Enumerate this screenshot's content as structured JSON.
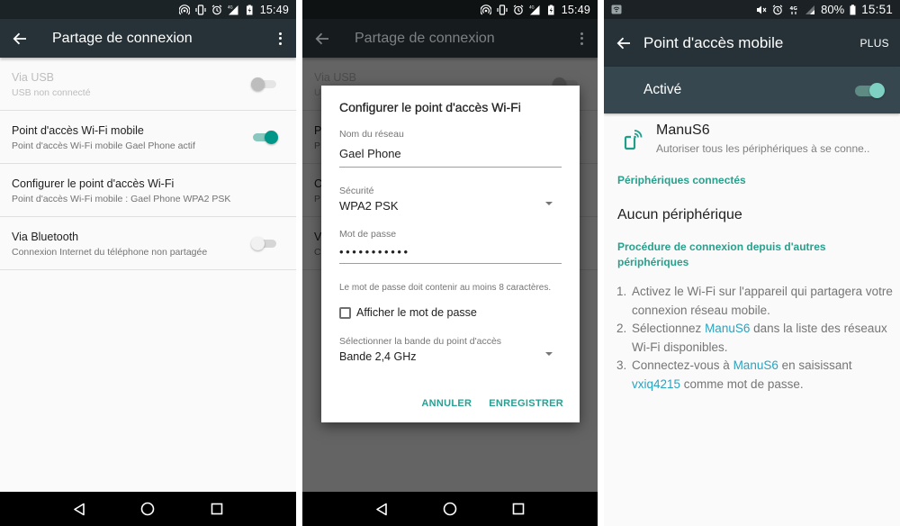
{
  "panel1": {
    "status_bar": {
      "icons": [
        "hotspot-icon",
        "vibrate-icon",
        "alarm-icon",
        "signal-4g-icon",
        "battery-charging-icon"
      ],
      "time": "15:49"
    },
    "app_bar": {
      "back_icon": "arrow-left-icon",
      "title": "Partage de connexion",
      "menu_icon": "more-vert-icon"
    },
    "items": [
      {
        "title": "Via USB",
        "subtitle": "USB non connecté",
        "toggle": false,
        "enabled": false
      },
      {
        "title": "Point d'accès Wi-Fi mobile",
        "subtitle": "Point d'accès Wi-Fi mobile Gael Phone actif",
        "toggle": true,
        "enabled": true
      },
      {
        "title": "Configurer le point d'accès Wi-Fi",
        "subtitle": "Point d'accès Wi-Fi mobile : Gael Phone WPA2 PSK"
      },
      {
        "title": "Via Bluetooth",
        "subtitle": "Connexion Internet du téléphone non partagée",
        "toggle": false,
        "enabled": true
      }
    ],
    "nav_bar": [
      "back-triangle-icon",
      "home-circle-icon",
      "recents-square-icon"
    ]
  },
  "panel2": {
    "status_bar": {
      "time": "15:49"
    },
    "app_bar": {
      "title": "Partage de connexion"
    },
    "background_items": [
      {
        "title": "Via USB",
        "subtitle": "USB non connecté"
      },
      {
        "title": "P",
        "subtitle": "P"
      },
      {
        "title": "C",
        "subtitle": "P"
      },
      {
        "title": "V",
        "subtitle": "C"
      }
    ],
    "dialog": {
      "title": "Configurer le point d'accès Wi-Fi",
      "network_name_label": "Nom du réseau",
      "network_name_value": "Gael Phone",
      "security_label": "Sécurité",
      "security_value": "WPA2 PSK",
      "password_label": "Mot de passe",
      "password_masked": "•••••••••••",
      "password_hint": "Le mot de passe doit contenir au moins 8 caractères.",
      "show_password_label": "Afficher le mot de passe",
      "show_password_checked": false,
      "band_label": "Sélectionner la bande du point d'accès",
      "band_value": "Bande 2,4 GHz",
      "cancel_label": "ANNULER",
      "save_label": "ENREGISTRER"
    }
  },
  "panel3": {
    "status_bar": {
      "left_icon": "wifi-hotspot-notification-icon",
      "icons": [
        "mute-icon",
        "alarm-icon",
        "4g-icon",
        "signal-icon"
      ],
      "battery": "80%",
      "time": "15:51"
    },
    "app_bar": {
      "title": "Point d'accès mobile",
      "more_label": "PLUS"
    },
    "master_toggle": {
      "label": "Activé",
      "on": true
    },
    "network": {
      "icon": "phone-wifi-icon",
      "name": "ManuS6",
      "subtitle": "Autoriser tous les périphériques à se conne.."
    },
    "connected_header": "Périphériques connectés",
    "no_devices": "Aucun périphérique",
    "procedure_header": "Procédure de connexion depuis d'autres périphériques",
    "steps": [
      {
        "num": "1.",
        "parts": [
          "Activez le Wi-Fi sur l'appareil qui partagera votre connexion réseau mobile."
        ]
      },
      {
        "num": "2.",
        "before": "Sélectionnez ",
        "highlight": "ManuS6",
        "after": " dans la liste des réseaux Wi-Fi disponibles."
      },
      {
        "num": "3.",
        "before": "Connectez-vous à ",
        "highlight": "ManuS6",
        "middle": " en saisissant ",
        "highlight2": "vxiq4215",
        "after": " comme mot de passe."
      }
    ]
  },
  "colors": {
    "accent": "#009688",
    "appbar": "#263238",
    "link": "#2aa3c0",
    "section_header": "#29a08c"
  }
}
